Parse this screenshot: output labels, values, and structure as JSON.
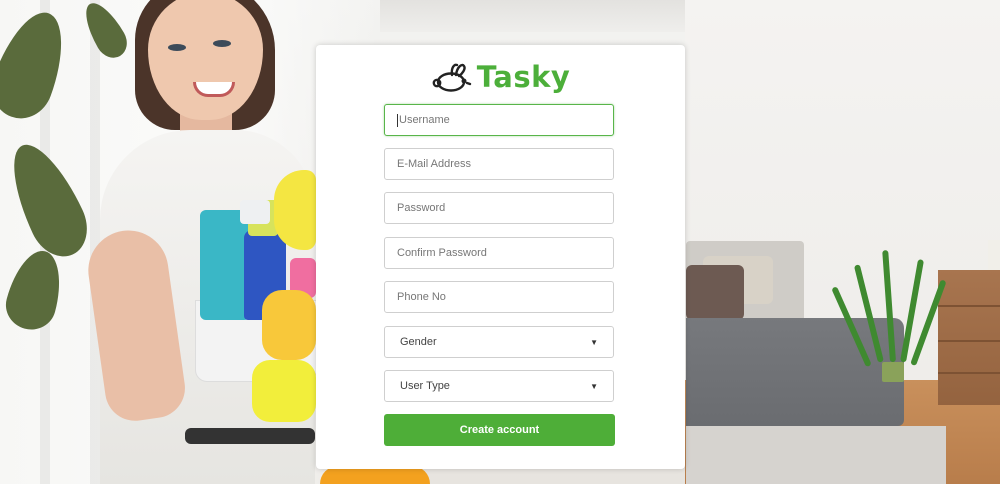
{
  "brand": {
    "name": "Tasky",
    "color": "#4caf3a",
    "icon": "bunny-logo-icon"
  },
  "form": {
    "fields": [
      {
        "name": "username",
        "placeholder": "Username",
        "focused": true
      },
      {
        "name": "email",
        "placeholder": "E-Mail Address",
        "focused": false
      },
      {
        "name": "password",
        "placeholder": "Password",
        "focused": false
      },
      {
        "name": "confirm_password",
        "placeholder": "Confirm Password",
        "focused": false
      },
      {
        "name": "phone",
        "placeholder": "Phone No",
        "focused": false
      }
    ],
    "selects": [
      {
        "name": "gender",
        "value": "Gender"
      },
      {
        "name": "user_type",
        "value": "User Type"
      }
    ],
    "submit_label": "Create account",
    "submit_color": "#4eae38"
  }
}
